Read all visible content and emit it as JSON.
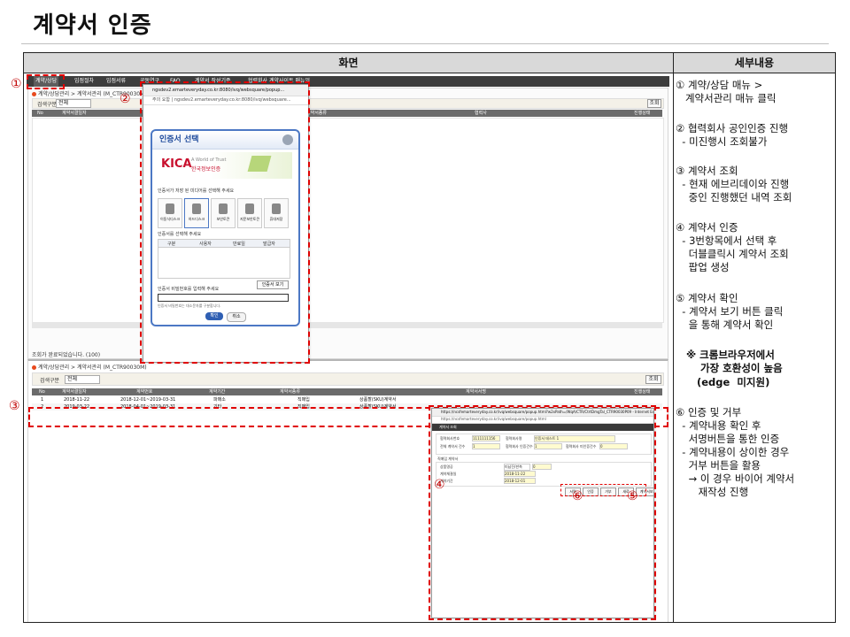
{
  "title": "계약서 인증",
  "table": {
    "col_screen": "화면",
    "col_detail": "세부내용"
  },
  "app": {
    "menu": [
      "계약/상담",
      "입점절차",
      "입점서류",
      "공동연구",
      "FAQ",
      "계약서 작성기준",
      "협력회사 계약사이트 매뉴얼"
    ],
    "breadcrumb_top": "계약/상담관리 > 계약서관리 (M_CTR90030M)",
    "search_label": "검색구분",
    "search_value": "전체",
    "search_button": "조회",
    "col_no": "No",
    "col_date": "계약서결일자",
    "col_contract_no": "계약번호",
    "col_type": "계약서종류",
    "col_period": "계약기간",
    "col_status": "진행상태",
    "col_sign": "계약서서명",
    "col_partner": "협력사",
    "status_msg": "조회가 완료되었습니다. (100)",
    "breadcrumb_bottom": "계약/상담관리 > 계약서관리 (M_CTR90030M)",
    "rows": [
      {
        "no": "1",
        "date": "2018-11-22",
        "period": "2018-12-01~2019-03-31",
        "type": "파매소",
        "kind": "직매입",
        "sign": "상품할(SKU)계약서"
      },
      {
        "no": "2",
        "date": "2019-03-22",
        "period": "2018-04-01~2019-03-31",
        "type": "기타",
        "kind": "직매입",
        "sign": "상품할(SKU)계약서"
      }
    ]
  },
  "popup_cert": {
    "url": "ngsdev2.emarteveryday.co.kr:8080/ivq/websquare/popup...",
    "addr": "주의 요함 | ngsdev2.emarteveryday.co.kr:8080/ivq/websquare...",
    "header": "인증서 선택",
    "kica_brand": "KICA",
    "kica_tag": "A World of Trust",
    "kica_name": "한국정보인증",
    "media_prompt": "인증서가 저장 된 미디어를 선택해 주세요",
    "media": [
      "이동식디스크",
      "하드디스크",
      "보안토큰",
      "지문보안토큰",
      "휴대저장"
    ],
    "list_prompt": "인증서를 선택해 주세요",
    "list_cols": [
      "구분",
      "사용자",
      "만료일",
      "발급자"
    ],
    "view_button": "인증서 보기",
    "pw_prompt": "인증서 비밀번호를 입력해 주세요",
    "pw_note": "인증서 비밀번호는 대소문자를 구분합니다.",
    "ok": "확인",
    "cancel": "취소"
  },
  "popup_contract": {
    "url": "https://ncsfemarteveryday.co.kr/ivq/websquare/popup.html?w2xPath=/WqA/CTR/CtrtDmgTal_CTR90030P09 - Internet Explorer",
    "addr": "https://ncsfemarteveryday.co.kr/ivq/websquare/popup.html",
    "header": "계약서 조회",
    "f1": "협력회사번호",
    "f1v": "1111111156",
    "f2": "협력회사명",
    "f2v": "인증서 테스트 1",
    "f3": "전체 계약서 건수",
    "f3v": "1",
    "f4": "협력회사 인증건수",
    "f4v": "1",
    "f5": "협력회사 미인증건수",
    "f5v": "0",
    "section": "직매입 계약서",
    "r1": "상품명공",
    "r1v": "미납진/판촉",
    "r2": "계약체결일",
    "r2v": "2018-11-22",
    "r3": "계약기간",
    "r3v": "2018-12-01",
    "buttons": [
      "서명",
      "인증",
      "거부",
      "새로",
      "계약서보기"
    ]
  },
  "markers": [
    "①",
    "②",
    "③",
    "④",
    "⑤",
    "⑥"
  ],
  "details": {
    "s1a": "① 계약/상담 매뉴 >",
    "s1b": "   계약서관리 매뉴 클릭",
    "s2a": "② 협력회사 공인인증 진행",
    "s2b": "  - 미진행시 조회불가",
    "s3a": "③ 계약서 조회",
    "s3b": "  - 현재 에브리데이와 진행",
    "s3c": "    중인 진행했던 내역 조회",
    "s4a": "④ 계약서 인증",
    "s4b": "  - 3번항목에서 선택 후",
    "s4c": "    더블클릭시 계약서 조회",
    "s4d": "    팝업 생성",
    "s5a": "⑤ 계약서 확인",
    "s5b": "  - 계약서 보기 버튼 클릭",
    "s5c": "    을 통해 계약서 확인",
    "n1": "※ 크롬브라우저에서",
    "n2": "가장 호환성이 높음",
    "n3": "(edge  미지원)",
    "s6a": "⑥ 인증 및 거부",
    "s6b": "  - 계약내용 확인 후",
    "s6c": "    서명버튼을 통한 인증",
    "s6d": "  - 계약내용이 상이한 경우",
    "s6e": "    거부 버튼을 활용",
    "s6f": "    → 이 경우 바이어 계약서",
    "s6g": "       재작성 진행"
  }
}
